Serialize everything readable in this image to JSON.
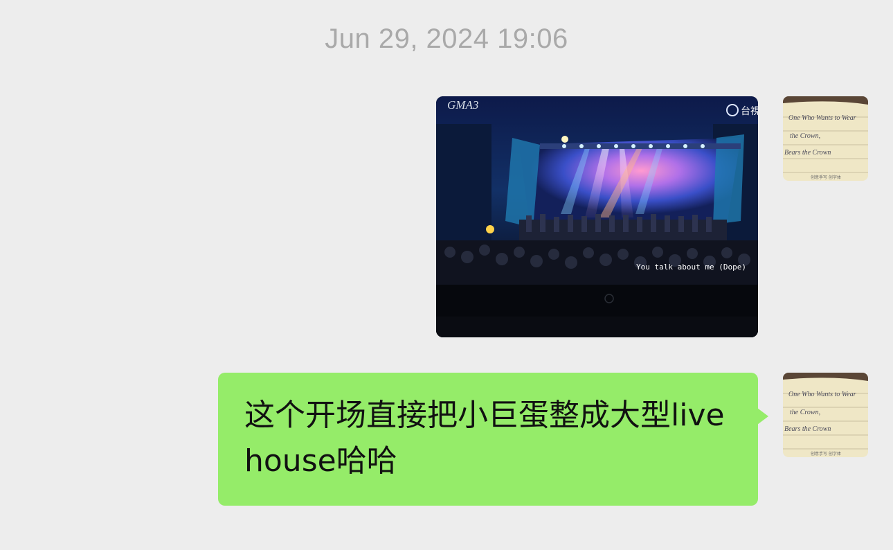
{
  "chat": {
    "timestamp": "Jun 29, 2024 19:06",
    "messages": [
      {
        "type": "image",
        "sender": "self",
        "image": {
          "channel_logo": "GMA3",
          "broadcaster_logo": "台視",
          "subtitle": "You talk about me  (Dope)",
          "monitor_brand_icon": "hp-logo-icon"
        }
      },
      {
        "type": "text",
        "sender": "self",
        "text": "这个开场直接把小巨蛋整成大型livehouse哈哈"
      }
    ],
    "avatar": {
      "handwriting_lines": [
        "One Who Wants to Wear",
        "the Crown,",
        "Bears the Crown"
      ],
      "caption": "创意手写 创字体"
    }
  },
  "colors": {
    "background": "#ededed",
    "bubble_self": "#95ec69",
    "timestamp": "#a9a9a9"
  }
}
